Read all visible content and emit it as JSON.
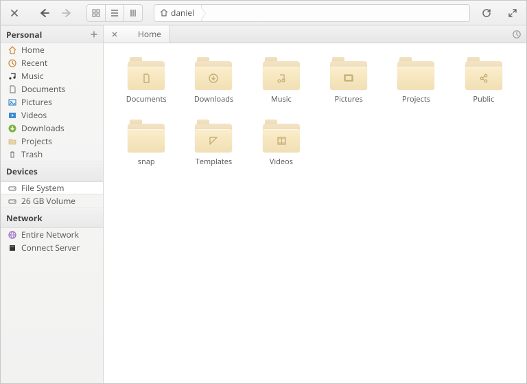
{
  "toolbar": {
    "breadcrumb_label": "daniel"
  },
  "tab": {
    "title": "Home"
  },
  "sidebar": {
    "sections": [
      {
        "title": "Personal",
        "items": [
          {
            "label": "Home",
            "icon": "home",
            "selected": false
          },
          {
            "label": "Recent",
            "icon": "clock",
            "selected": false
          },
          {
            "label": "Music",
            "icon": "music",
            "selected": false
          },
          {
            "label": "Documents",
            "icon": "doc",
            "selected": false
          },
          {
            "label": "Pictures",
            "icon": "picture",
            "selected": false
          },
          {
            "label": "Videos",
            "icon": "video",
            "selected": false
          },
          {
            "label": "Downloads",
            "icon": "download",
            "selected": false
          },
          {
            "label": "Projects",
            "icon": "folder",
            "selected": false
          },
          {
            "label": "Trash",
            "icon": "trash",
            "selected": false
          }
        ]
      },
      {
        "title": "Devices",
        "items": [
          {
            "label": "File System",
            "icon": "drive",
            "selected": true
          },
          {
            "label": "26 GB Volume",
            "icon": "drive",
            "selected": false
          }
        ]
      },
      {
        "title": "Network",
        "items": [
          {
            "label": "Entire Network",
            "icon": "network",
            "selected": false
          },
          {
            "label": "Connect Server",
            "icon": "server",
            "selected": false
          }
        ]
      }
    ]
  },
  "folders": [
    {
      "name": "Documents",
      "glyph": "doc"
    },
    {
      "name": "Downloads",
      "glyph": "download"
    },
    {
      "name": "Music",
      "glyph": "music"
    },
    {
      "name": "Pictures",
      "glyph": "picture"
    },
    {
      "name": "Projects",
      "glyph": "blank"
    },
    {
      "name": "Public",
      "glyph": "share"
    },
    {
      "name": "snap",
      "glyph": "blank"
    },
    {
      "name": "Templates",
      "glyph": "template"
    },
    {
      "name": "Videos",
      "glyph": "video"
    }
  ]
}
